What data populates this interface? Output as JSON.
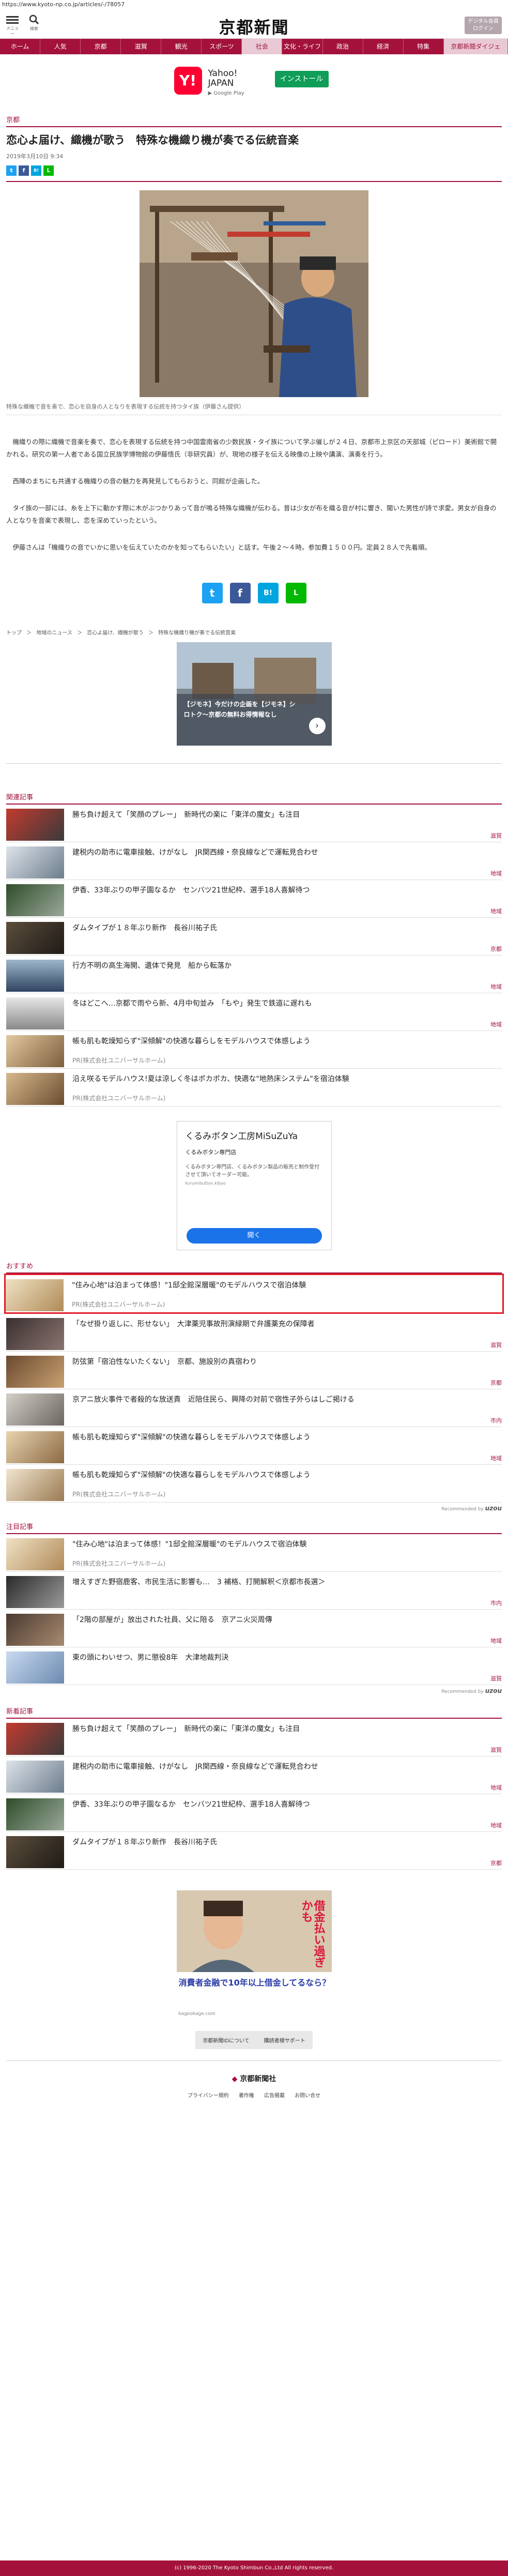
{
  "url": "https://www.kyoto-np.co.jp/articles/-/78057",
  "header": {
    "menu_label": "メニュー",
    "search_label": "検索",
    "logo": "京都新聞",
    "member_button": "デジタル会員\nログイン"
  },
  "nav": [
    "ホーム",
    "人気",
    "京都",
    "滋賀",
    "観光",
    "スポーツ",
    "社会",
    "文化・ライフ",
    "政治",
    "経済",
    "特集",
    "京都新聞ダイジェ"
  ],
  "app_banner": {
    "icon_text": "Y!",
    "name_line1": "Yahoo!",
    "name_line2": "JAPAN",
    "store": "▶ Google Play",
    "install_label": "インストール"
  },
  "article": {
    "section": "京都",
    "title": "恋心よ届け、織機が歌う　特殊な機織り機が奏でる伝統音楽",
    "date": "2019年3月10日 9:34",
    "photo_caption": "特殊な織機で音を奏で、恋心を自身の人となりを表現する伝統を持つタイ族（伊藤さん提供）",
    "paragraphs": [
      "機織りの際に織機で音楽を奏で、恋心を表現する伝統を持つ中国雲南省の少数民族・タイ族について学ぶ催しが２４日、京都市上京区の天部城（ピロード）美術館で開かれる。研究の第一人者である国立民族学博物館の伊藤悟氏（非研究員）が、現地の様子を伝える映像の上映や講演、演奏を行う。",
      "西陣のまちにも共通する機織りの音の魅力を再発見してもらおうと、同館が企画した。",
      "タイ族の一部には、糸を上下に動かす際に木がぶつかりあって音が鳴る特殊な織機が伝わる。昔は少女が布を織る音が村に響き、聞いた男性が詩で求愛。男女が自身の人となりを音楽で表現し、恋を深めていったという。",
      "伊藤さんは「機織りの音でいかに思いを伝えていたのかを知ってもらいたい」と話す。午後２〜４時。参加費１５００円。定員２８人で先着順。"
    ],
    "share_small": [
      "t",
      "f",
      "B!",
      "L"
    ],
    "share_big": [
      "t",
      "f",
      "B!",
      "L"
    ]
  },
  "breadcrumbs": [
    "トップ",
    "＞",
    "地域のニュース",
    "＞",
    "恋心よ届け、織機が歌う",
    "＞",
    "特殊な機織り機が奏でる伝統音楽"
  ],
  "ad1": {
    "label": "【ジモネ】今だけの企画を【ジモネ】シロトク〜京都の無料お得情報なし",
    "arrow": "›"
  },
  "related": {
    "heading": "関連記事",
    "items": [
      {
        "title": "勝ち負け超えて「笑顔のプレー」　新時代の楽に「東洋の魔女」も注目",
        "tag": "滋賀"
      },
      {
        "title": "建税内の助市に電車接触、けがなし　JR関西線・奈良線などで運転見合わせ",
        "tag": "地域"
      },
      {
        "title": "伊香、33年ぶりの甲子園なるか　センバツ21世紀枠、選手18人喜解待つ",
        "tag": "地域"
      },
      {
        "title": "ダムタイプが１８年ぶり新作　長谷川祐子氏",
        "tag": "京都"
      },
      {
        "title": "行方不明の高生海開、遺体で発見　船から転落か",
        "tag": "地域"
      },
      {
        "title": "冬はどこへ…京都で雨やら新、4月中旬並み　「もや」発生で鉄道に遅れも",
        "tag": "地域"
      },
      {
        "title": "帳も肌も乾燥知らず\"深傾解\"の快適な暮らしをモデルハウスで体感しよう",
        "pr": "PR(株式会社ユニバーサルホーム)"
      },
      {
        "title": "沿え咲るモデルハウス!夏は涼しく冬はポカポカ、快適な\"地熱床システム\"を宿泊体験",
        "pr": "PR(株式会社ユニバーサルホーム)"
      }
    ]
  },
  "ad2": {
    "title": "くるみボタン工房MiSuZuYa",
    "sub": "くるみボタン専門店",
    "desc": "くるみボタン専門店、くるみボタン製品の販売と制作受付させて頂いてオーダー可能。",
    "domain": "kurumibutton.kibyo",
    "button": "開く"
  },
  "recommend": {
    "heading": "おすすめ",
    "items": [
      {
        "title": "\"住み心地\"は泊まって体感！\"1邸全館深層暖\"のモデルハウスで宿泊体験",
        "pr": "PR(株式会社ユニバーサルホーム)",
        "highlight": true
      },
      {
        "title": "「なぜ掛り返しに、形せない」　大津薬児事故刑演緑期で弁護薬充の保障者",
        "tag": "滋賀"
      },
      {
        "title": "防弦第「宿泊性ないたくない」　京都、施設別の真宿わり",
        "tag": "京都"
      },
      {
        "title": "京アニ放火事件で者殺的な放送責　近陪住民ら、興降の対前で宿性子外らはしご掲ける",
        "tag": "市内"
      },
      {
        "title": "帳も肌も乾燥知らず\"深傾解\"の快適な暮らしをモデルハウスで体感しよう",
        "tag": "地域"
      },
      {
        "title": "帳も肌も乾燥知らず\"深傾解\"の快適な暮らしをモデルハウスで体感しよう",
        "pr": "PR(株式会社ユニバーサルホーム)"
      }
    ],
    "by": "Recommended by",
    "by_brand": "uzou"
  },
  "attention": {
    "heading": "注目記事",
    "items": [
      {
        "title": "\"住み心地\"は泊まって体感！\"1邸全館深層暖\"のモデルハウスで宿泊体験",
        "pr": "PR(株式会社ユニバーサルホーム)"
      },
      {
        "title": "増えすぎた野宿鹿客、市民生活に影響も…　3 補格、打開解釈＜京都市長選＞",
        "tag": "市内"
      },
      {
        "title": "「2階の部屋が」放出された社員、父に陪る　京アニ火災周傳",
        "tag": "地域"
      },
      {
        "title": "東の頭にわいせつ、男に懲役8年　大津地裁判決",
        "tag": "滋賀"
      }
    ],
    "by": "Recommended by",
    "by_brand": "uzou"
  },
  "latest": {
    "heading": "新着記事",
    "items": [
      {
        "title": "勝ち負け超えて「笑顔のプレー」　新時代の楽に「東洋の魔女」も注目",
        "tag": "滋賀"
      },
      {
        "title": "建税内の助市に電車接触、けがなし　JR関西線・奈良線などで運転見合わせ",
        "tag": "地域"
      },
      {
        "title": "伊香、33年ぶりの甲子園なるか　センバツ21世紀枠、選手18人喜解待つ",
        "tag": "地域"
      },
      {
        "title": "ダムタイプが１８年ぶり新作　長谷川祐子氏",
        "tag": "京都"
      }
    ]
  },
  "ad3": {
    "headline": "消費者金融で10年以上借金してるなら？",
    "source": "kageokage.com",
    "vertical": "借金払い過ぎかも"
  },
  "footer": {
    "links": [
      "京都新聞IDについて",
      "購読者様サポート"
    ],
    "logo": "京都新聞社",
    "nav": [
      "プライバシー規約",
      "著作権",
      "広告掲載",
      "お問い合せ"
    ],
    "copyright": "(c) 1996-2020 The Kyoto Shimbun Co.,Ltd All rights reserved."
  }
}
